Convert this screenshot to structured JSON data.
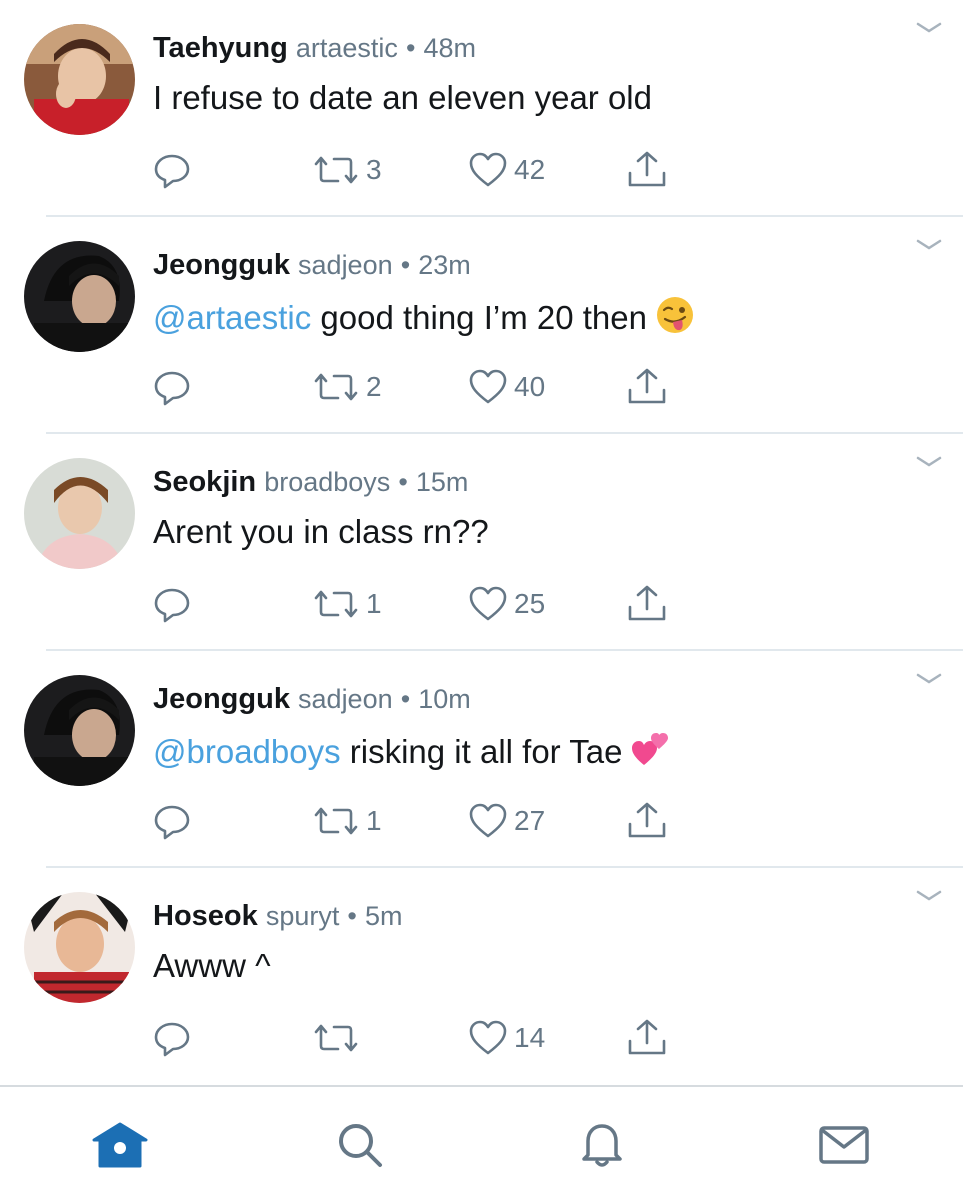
{
  "colors": {
    "accent": "#1c6fb4",
    "mention": "#4aa1de",
    "muted": "#657786",
    "divider": "#e1e8ed"
  },
  "tweets": [
    {
      "name": "Taehyung",
      "handle": "artaestic",
      "dot": "•",
      "time": "48m",
      "mention": "",
      "text": "I refuse to date an eleven year old",
      "emoji": "",
      "retweets": "3",
      "likes": "42"
    },
    {
      "name": "Jeongguk",
      "handle": "sadjeon",
      "dot": "•",
      "time": "23m",
      "mention": "@artaestic",
      "text": " good thing I’m 20 then",
      "emoji": "winking-face-with-tongue",
      "retweets": "2",
      "likes": "40"
    },
    {
      "name": "Seokjin",
      "handle": "broadboys",
      "dot": "•",
      "time": "15m",
      "mention": "",
      "text": "Arent you in class rn??",
      "emoji": "",
      "retweets": "1",
      "likes": "25"
    },
    {
      "name": "Jeongguk",
      "handle": "sadjeon",
      "dot": "•",
      "time": "10m",
      "mention": "@broadboys",
      "text": " risking it all for Tae",
      "emoji": "two-hearts",
      "retweets": "1",
      "likes": "27"
    },
    {
      "name": "Hoseok",
      "handle": "spuryt",
      "dot": "•",
      "time": "5m",
      "mention": "",
      "text": "Awww ^",
      "emoji": "",
      "retweets": "",
      "likes": "14"
    }
  ],
  "tabbar": {
    "items": [
      "home-icon",
      "search-icon",
      "bell-icon",
      "envelope-icon"
    ],
    "active": "home-icon"
  }
}
